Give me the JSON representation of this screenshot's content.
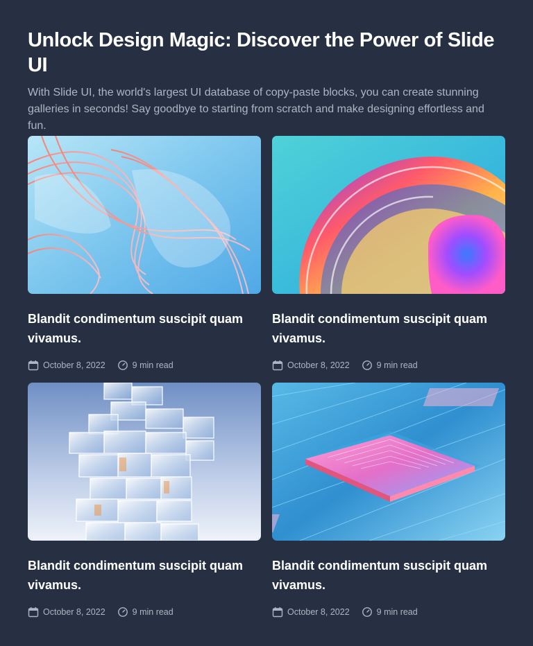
{
  "hero": {
    "title": "Unlock Design Magic: Discover the Power of Slide UI",
    "description": "With Slide UI, the world's largest UI database of copy-paste blocks, you can create stunning galleries in seconds! Say goodbye to starting from scratch and make designing effortless and fun."
  },
  "colors": {
    "background": "#263042",
    "title": "#ffffff",
    "muted_text": "#aeb6c3"
  },
  "posts": [
    {
      "image": "abstract glass ribbons in pink and blue",
      "title": "Blandit condimentum suscipit quam vivamus.",
      "date": "October 8, 2022",
      "read_time": "9 min read",
      "date_icon": "calendar-icon",
      "time_icon": "clock-icon"
    },
    {
      "image": "swirling iridescent rainbow glass",
      "title": "Blandit condimentum suscipit quam vivamus.",
      "date": "October 8, 2022",
      "read_time": "9 min read",
      "date_icon": "calendar-icon",
      "time_icon": "clock-icon"
    },
    {
      "image": "stacked glass cubes tower",
      "title": "Blandit condimentum suscipit quam vivamus.",
      "date": "October 8, 2022",
      "read_time": "9 min read",
      "date_icon": "calendar-icon",
      "time_icon": "clock-icon"
    },
    {
      "image": "isometric microchip circuit board in pink and blue",
      "title": "Blandit condimentum suscipit quam vivamus.",
      "date": "October 8, 2022",
      "read_time": "9 min read",
      "date_icon": "calendar-icon",
      "time_icon": "clock-icon"
    }
  ]
}
